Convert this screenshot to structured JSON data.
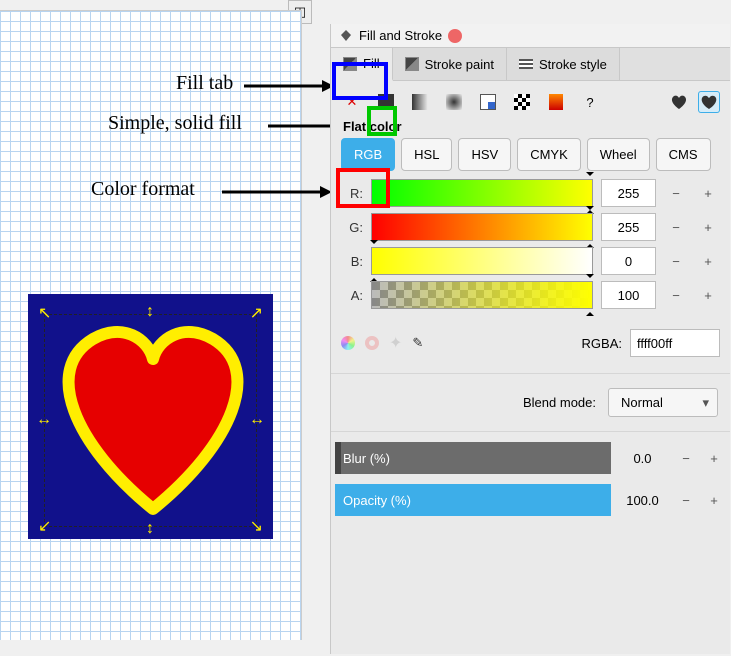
{
  "annotations": {
    "fillTab": "Fill tab",
    "solidFill": "Simple, solid fill",
    "colorFormat": "Color format"
  },
  "panel": {
    "title": "Fill and Stroke",
    "tabs": {
      "fill": "Fill",
      "strokePaint": "Stroke paint",
      "strokeStyle": "Stroke style"
    },
    "paintRow": {
      "question": "?"
    },
    "sectionLabel": "Flat color",
    "formats": {
      "rgb": "RGB",
      "hsl": "HSL",
      "hsv": "HSV",
      "cmyk": "CMYK",
      "wheel": "Wheel",
      "cms": "CMS"
    },
    "channels": {
      "r": {
        "label": "R:",
        "value": "255"
      },
      "g": {
        "label": "G:",
        "value": "255"
      },
      "b": {
        "label": "B:",
        "value": "0"
      },
      "a": {
        "label": "A:",
        "value": "100"
      }
    },
    "rgba": {
      "label": "RGBA:",
      "value": "ffff00ff"
    },
    "blend": {
      "label": "Blend mode:",
      "value": "Normal"
    },
    "blur": {
      "label": "Blur (%)",
      "value": "0.0"
    },
    "opacity": {
      "label": "Opacity (%)",
      "value": "100.0"
    },
    "minus": "−",
    "plus": "+"
  },
  "icons": {
    "close": "✕",
    "page": "◰",
    "eyedrop": "✎"
  }
}
